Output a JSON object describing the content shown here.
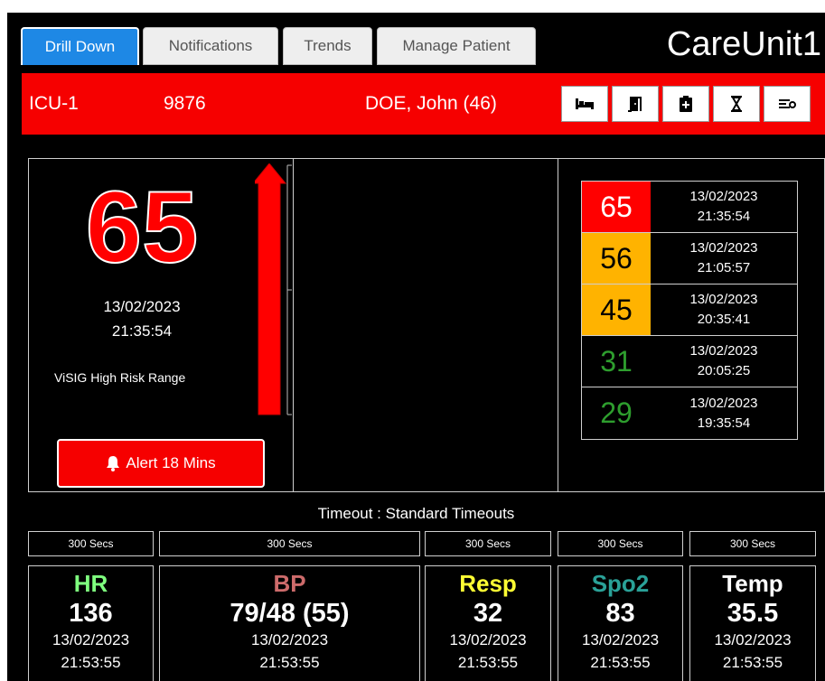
{
  "header": {
    "app_title": "CareUnit1",
    "tabs": [
      {
        "label": "Drill Down",
        "active": true
      },
      {
        "label": "Notifications",
        "active": false
      },
      {
        "label": "Trends",
        "active": false
      },
      {
        "label": "Manage Patient",
        "active": false
      }
    ]
  },
  "patient": {
    "unit": "ICU-1",
    "id": "9876",
    "name": "DOE, John (46)",
    "actions": [
      "bed-icon",
      "door-exit-icon",
      "clipboard-icon",
      "hourglass-icon",
      "transfer-icon"
    ]
  },
  "score": {
    "value": "65",
    "date": "13/02/2023",
    "time": "21:35:54",
    "range_label": "ViSIG High Risk Range",
    "alert_label": "Alert 18 Mins",
    "risk_level_fraction": 1.0
  },
  "history": [
    {
      "value": "65",
      "date": "13/02/2023",
      "time": "21:35:54",
      "bg": "#ff0000",
      "fg": "#ffffff"
    },
    {
      "value": "56",
      "date": "13/02/2023",
      "time": "21:05:57",
      "bg": "#ffb300",
      "fg": "#000000"
    },
    {
      "value": "45",
      "date": "13/02/2023",
      "time": "20:35:41",
      "bg": "#ffb300",
      "fg": "#000000"
    },
    {
      "value": "31",
      "date": "13/02/2023",
      "time": "20:05:25",
      "bg": "#000000",
      "fg": "#2e9e2e"
    },
    {
      "value": "29",
      "date": "13/02/2023",
      "time": "19:35:54",
      "bg": "#000000",
      "fg": "#2e9e2e"
    }
  ],
  "timeouts": {
    "title": "Timeout : Standard Timeouts",
    "values": [
      "300 Secs",
      "300 Secs",
      "300 Secs",
      "300 Secs",
      "300 Secs"
    ]
  },
  "vitals": [
    {
      "label": "HR",
      "value": "136",
      "date": "13/02/2023",
      "time": "21:53:55",
      "color": "#7fff7f"
    },
    {
      "label": "BP",
      "value": "79/48 (55)",
      "date": "13/02/2023",
      "time": "21:53:55",
      "color": "#cd6b6b"
    },
    {
      "label": "Resp",
      "value": "32",
      "date": "13/02/2023",
      "time": "21:53:55",
      "color": "#ffff33"
    },
    {
      "label": "Spo2",
      "value": "83",
      "date": "13/02/2023",
      "time": "21:53:55",
      "color": "#2aa198"
    },
    {
      "label": "Temp",
      "value": "35.5",
      "date": "13/02/2023",
      "time": "21:53:55",
      "color": "#ffffff"
    }
  ]
}
